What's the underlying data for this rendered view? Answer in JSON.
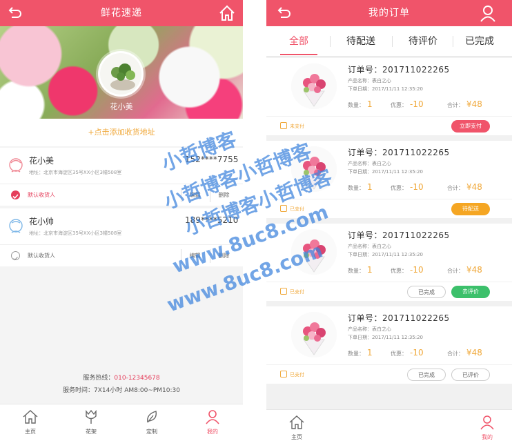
{
  "left_screen": {
    "header": {
      "title": "鲜花速递"
    },
    "profile": {
      "name": "花小美"
    },
    "add_address_label": "+点击添加收货地址",
    "addresses": [
      {
        "name": "花小美",
        "phone": "152****7755",
        "detail": "地址：北京市海淀区35号XX小区3幢508室",
        "default_label": "默认收货人",
        "edit_label": "编辑",
        "delete_label": "删除",
        "is_default": true
      },
      {
        "name": "花小帅",
        "phone": "189****5210",
        "detail": "地址：北京市海淀区35号XX小区3幢508室",
        "default_label": "默认收货人",
        "edit_label": "编辑",
        "delete_label": "删除",
        "is_default": false
      }
    ],
    "service": {
      "hotline_label": "服务热线：",
      "hotline_number": "010-12345678",
      "hours": "服务时间：7X14小时 AM8:00~PM10:30"
    },
    "tabs": [
      {
        "label": "主页",
        "icon": "home-icon"
      },
      {
        "label": "花架",
        "icon": "tulip-icon"
      },
      {
        "label": "定制",
        "icon": "leaf-icon"
      },
      {
        "label": "我的",
        "icon": "user-icon",
        "active": true
      }
    ]
  },
  "right_screen": {
    "header": {
      "title": "我的订单"
    },
    "segments": [
      {
        "label": "全部",
        "active": true
      },
      {
        "label": "待配送"
      },
      {
        "label": "待评价"
      },
      {
        "label": "已完成"
      }
    ],
    "orders": [
      {
        "order_no": "订单号：201711022265",
        "product": "产品名称：表白之心",
        "date": "下单日期：2017/11/11  12:35:20",
        "qty_label": "数量：",
        "qty": "1",
        "disc_label": "优惠：",
        "discount": "-10",
        "total_label": "合计：",
        "total": "¥48",
        "status": "未支付",
        "buttons": [
          {
            "label": "立即支付",
            "style": "red"
          }
        ]
      },
      {
        "order_no": "订单号：201711022265",
        "product": "产品名称：表白之心",
        "date": "下单日期：2017/11/11  12:35:20",
        "qty_label": "数量：",
        "qty": "1",
        "disc_label": "优惠：",
        "discount": "-10",
        "total_label": "合计：",
        "total": "¥48",
        "status": "已支付",
        "buttons": [
          {
            "label": "待配送",
            "style": "orange"
          }
        ]
      },
      {
        "order_no": "订单号：201711022265",
        "product": "产品名称：表白之心",
        "date": "下单日期：2017/11/11  12:35:20",
        "qty_label": "数量：",
        "qty": "1",
        "disc_label": "优惠：",
        "discount": "-10",
        "total_label": "合计：",
        "total": "¥48",
        "status": "已支付",
        "buttons": [
          {
            "label": "已完成",
            "style": "outline"
          },
          {
            "label": "去评价",
            "style": "green"
          }
        ]
      },
      {
        "order_no": "订单号：201711022265",
        "product": "产品名称：表白之心",
        "date": "下单日期：2017/11/11  12:35:20",
        "qty_label": "数量：",
        "qty": "1",
        "disc_label": "优惠：",
        "discount": "-10",
        "total_label": "合计：",
        "total": "¥48",
        "status": "已支付",
        "buttons": [
          {
            "label": "已完成",
            "style": "outline"
          },
          {
            "label": "已评价",
            "style": "outline"
          }
        ]
      }
    ],
    "tabs": [
      {
        "label": "主页",
        "icon": "home-icon"
      },
      {
        "label": "我的",
        "icon": "user-icon",
        "active": true
      }
    ]
  },
  "watermark": {
    "line1": "小哲博客",
    "line2": "小哲博客小哲博客",
    "line3": "www.8uc8.com"
  },
  "colors": {
    "primary": "#f0546a",
    "accent": "#f0a93c",
    "green": "#3cc06b"
  }
}
